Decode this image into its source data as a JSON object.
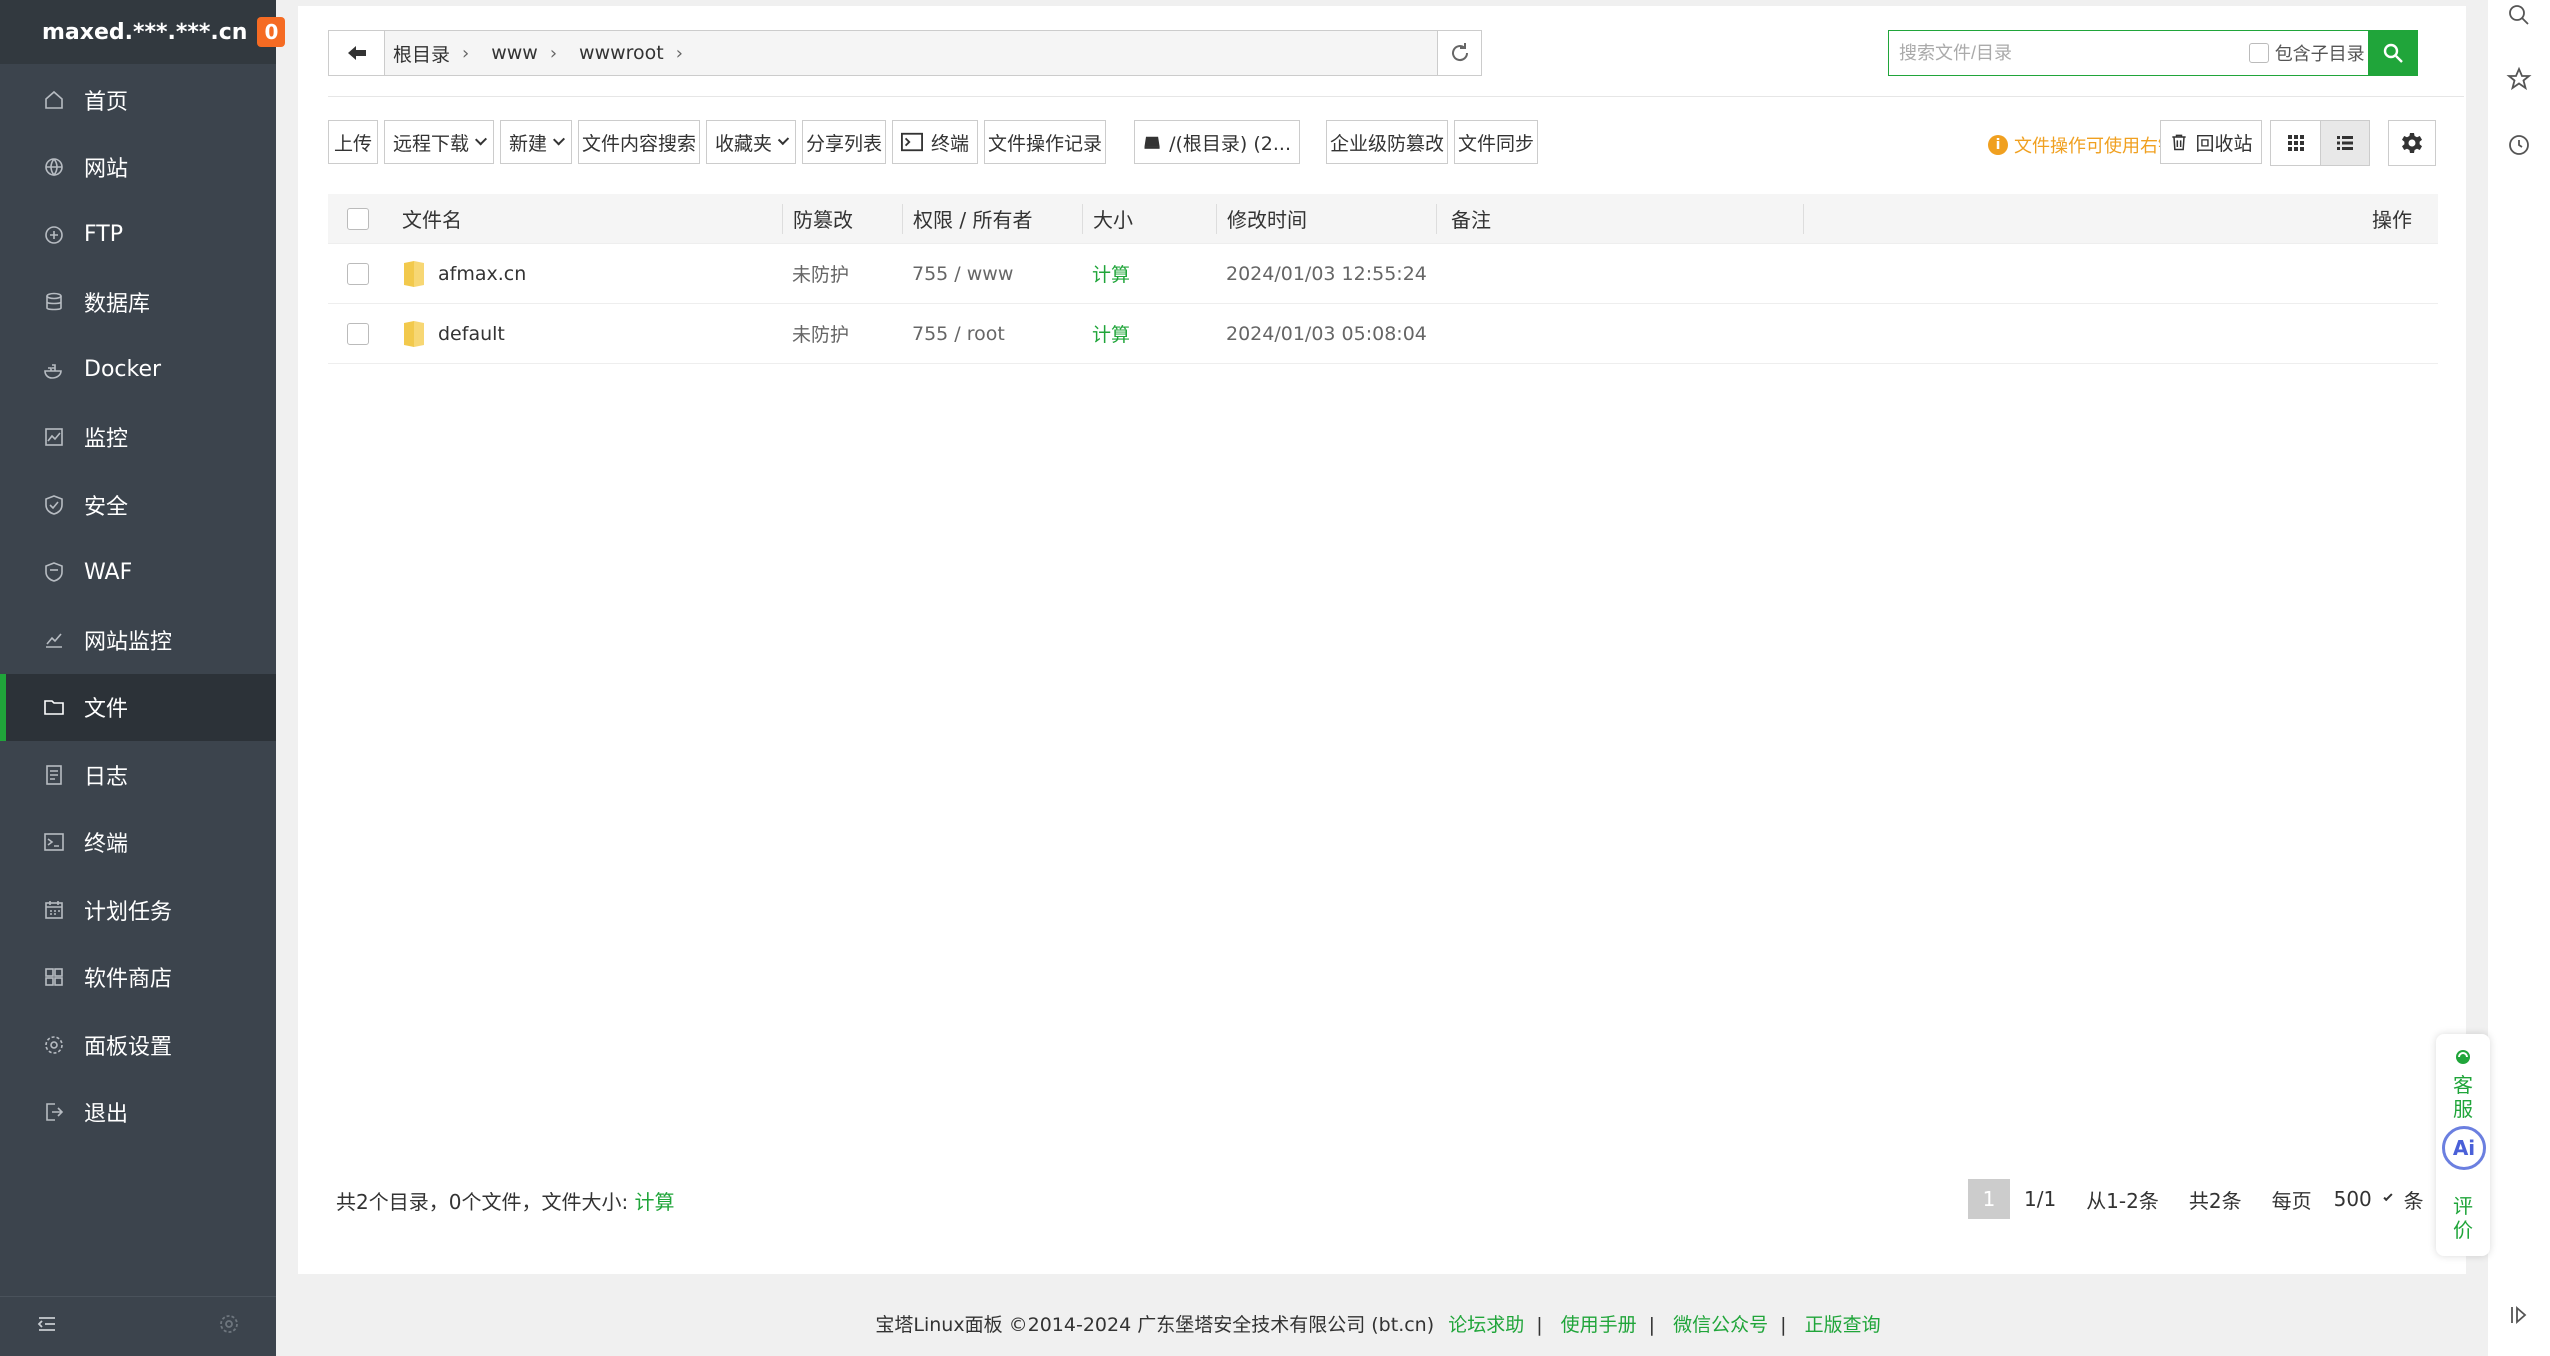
{
  "sidebar": {
    "host": "maxed.***.***.cn",
    "badge": "0",
    "items": [
      {
        "label": "首页",
        "icon": "home-icon"
      },
      {
        "label": "网站",
        "icon": "globe-icon"
      },
      {
        "label": "FTP",
        "icon": "ftp-icon"
      },
      {
        "label": "数据库",
        "icon": "database-icon"
      },
      {
        "label": "Docker",
        "icon": "docker-icon"
      },
      {
        "label": "监控",
        "icon": "monitor-icon"
      },
      {
        "label": "安全",
        "icon": "shield-icon"
      },
      {
        "label": "WAF",
        "icon": "waf-icon"
      },
      {
        "label": "网站监控",
        "icon": "chart-icon"
      },
      {
        "label": "文件",
        "icon": "folder-icon",
        "active": true
      },
      {
        "label": "日志",
        "icon": "log-icon"
      },
      {
        "label": "终端",
        "icon": "terminal-icon"
      },
      {
        "label": "计划任务",
        "icon": "calendar-icon"
      },
      {
        "label": "软件商店",
        "icon": "apps-icon"
      },
      {
        "label": "面板设置",
        "icon": "gear-icon"
      },
      {
        "label": "退出",
        "icon": "logout-icon"
      }
    ]
  },
  "breadcrumb": [
    "根目录",
    "www",
    "wwwroot"
  ],
  "search": {
    "placeholder": "搜索文件/目录",
    "include_sub_label": "包含子目录"
  },
  "toolbar": {
    "upload": "上传",
    "remote_download": "远程下载",
    "new": "新建",
    "content_search": "文件内容搜索",
    "favorites": "收藏夹",
    "share_list": "分享列表",
    "terminal": "终端",
    "op_log": "文件操作记录",
    "disk": "/(根目录) (2...",
    "tamper": "企业级防篡改",
    "sync": "文件同步",
    "tip": "文件操作可使用右键",
    "recycle": "回收站"
  },
  "table": {
    "headers": {
      "name": "文件名",
      "protect": "防篡改",
      "perm": "权限 / 所有者",
      "size": "大小",
      "mtime": "修改时间",
      "note": "备注",
      "ops": "操作"
    },
    "rows": [
      {
        "name": "afmax.cn",
        "protect": "未防护",
        "perm": "755 / www",
        "size": "计算",
        "mtime": "2024/01/03 12:55:24",
        "note": ""
      },
      {
        "name": "default",
        "protect": "未防护",
        "perm": "755 / root",
        "size": "计算",
        "mtime": "2024/01/03 05:08:04",
        "note": ""
      }
    ]
  },
  "summary": {
    "text": "共2个目录，0个文件，文件大小:",
    "calc": "计算"
  },
  "pager": {
    "current": "1",
    "pages": "1/1",
    "range": "从1-2条",
    "total": "共2条",
    "per_page_label": "每页",
    "per_page": "500",
    "unit": "条"
  },
  "float_widget": {
    "service": "客服",
    "ai": "Ai",
    "rate": "评价"
  },
  "footer": {
    "copyright": "宝塔Linux面板 ©2014-2024 广东堡塔安全技术有限公司 (bt.cn)",
    "links": [
      "论坛求助",
      "使用手册",
      "微信公众号",
      "正版查询"
    ]
  },
  "colors": {
    "accent": "#20a53a",
    "sidebar_bg": "#3c444d",
    "badge": "#f56b23",
    "tip": "#f0a020"
  }
}
